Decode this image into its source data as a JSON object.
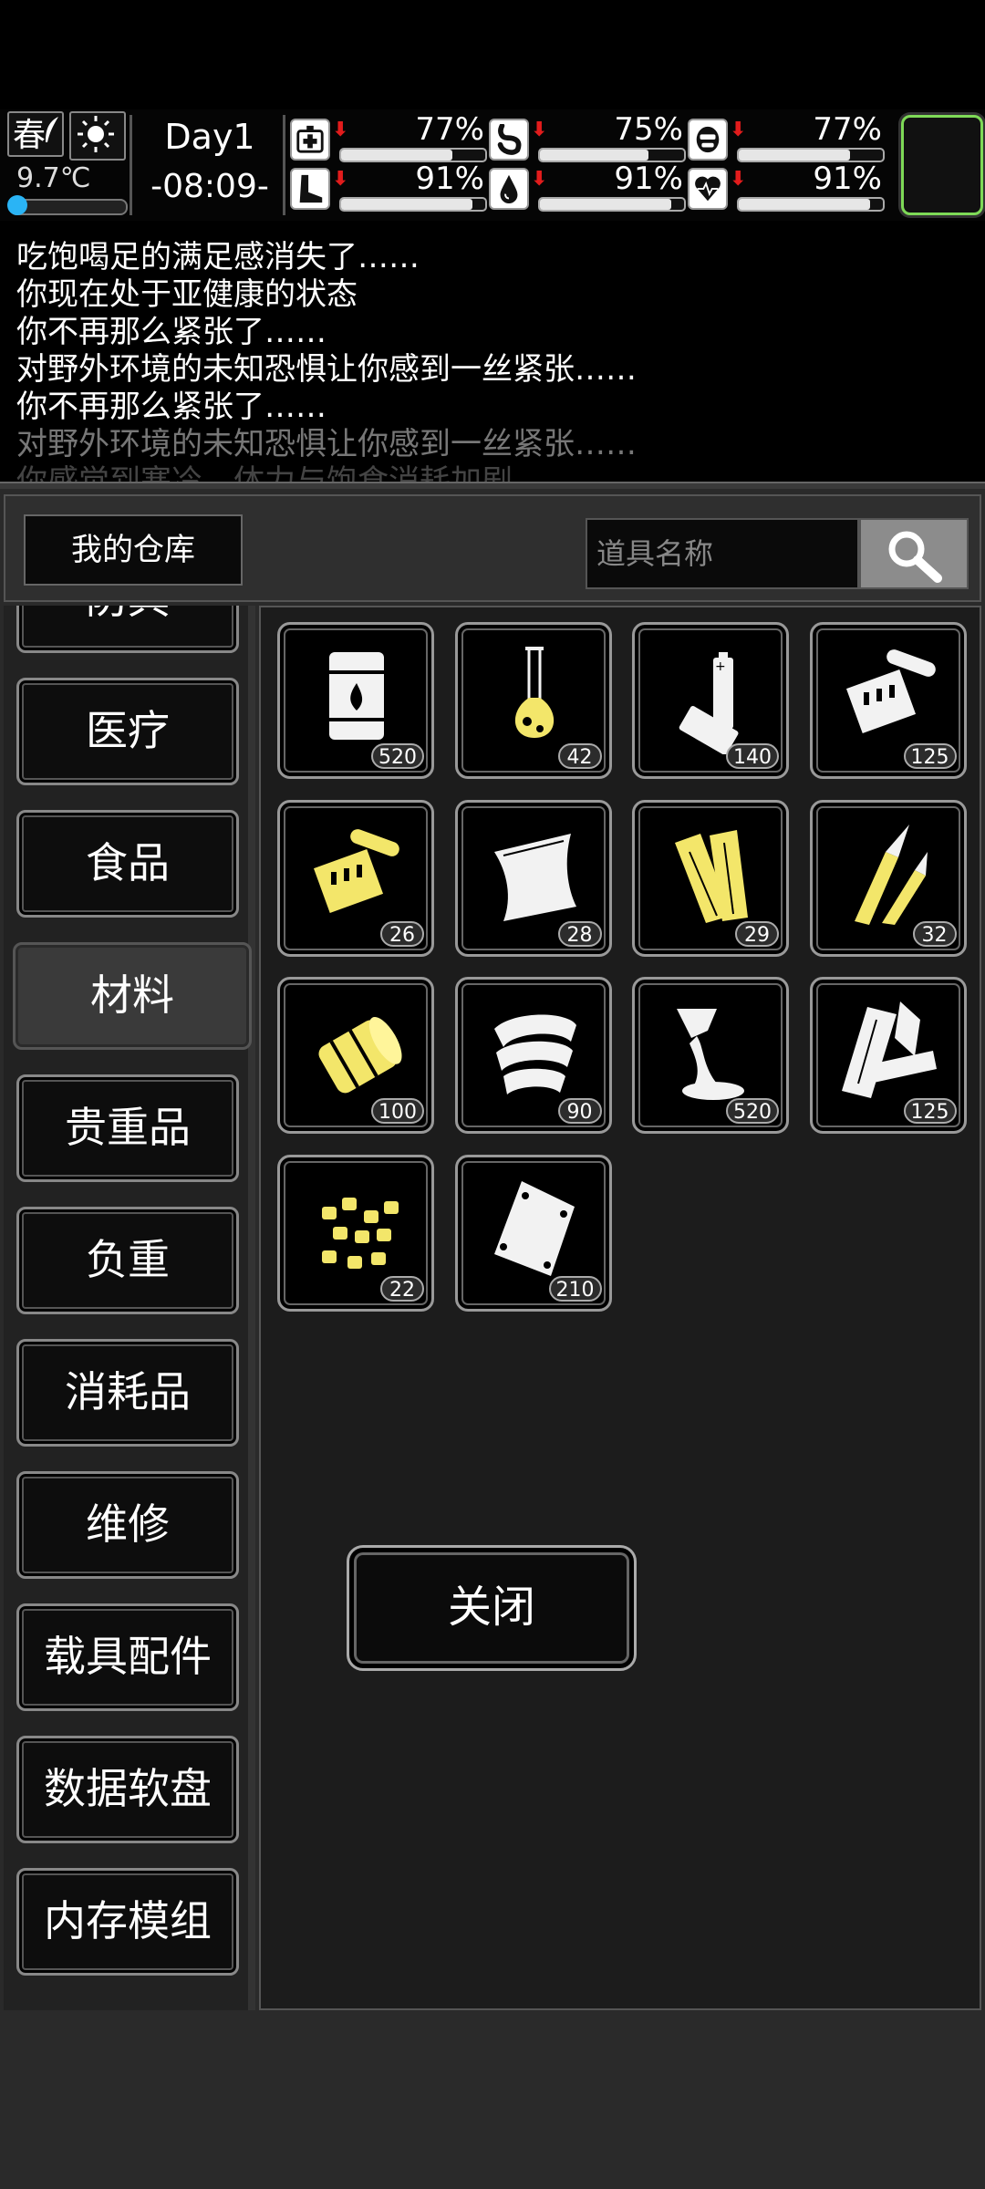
{
  "hud": {
    "season": "春",
    "temperature": "9.7℃",
    "temperature_level": 0.1,
    "day": "Day1",
    "time": "-08:09-",
    "stats": [
      {
        "icon": "medkit-icon",
        "value": "77%",
        "level": 0.77
      },
      {
        "icon": "stomach-icon",
        "value": "75%",
        "level": 0.75
      },
      {
        "icon": "mask-icon",
        "value": "77%",
        "level": 0.77
      },
      {
        "icon": "boot-icon",
        "value": "91%",
        "level": 0.91
      },
      {
        "icon": "water-drop-icon",
        "value": "91%",
        "level": 0.91
      },
      {
        "icon": "heart-icon",
        "value": "91%",
        "level": 0.91
      }
    ]
  },
  "log": [
    "吃饱喝足的满足感消失了……",
    "你现在处于亚健康的状态",
    "你不再那么紧张了……",
    "对野外环境的未知恐惧让你感到一丝紧张……",
    "你不再那么紧张了……",
    "对野外环境的未知恐惧让你感到一丝紧张……",
    "你感觉到寒冷，体力与饱食消耗加剧"
  ],
  "warehouse": {
    "title": "我的仓库",
    "search_placeholder": "道具名称"
  },
  "categories": [
    "防具",
    "医疗",
    "食品",
    "材料",
    "贵重品",
    "负重",
    "消耗品",
    "维修",
    "载具配件",
    "数据软盘",
    "内存模组"
  ],
  "active_category": "材料",
  "items": [
    {
      "icon": "fuel-barrel-icon",
      "count": "520"
    },
    {
      "icon": "chemical-flask-icon",
      "count": "42"
    },
    {
      "icon": "battery-icon",
      "count": "140"
    },
    {
      "icon": "electronic-parts-icon",
      "count": "125"
    },
    {
      "icon": "circuit-parts-icon",
      "count": "26"
    },
    {
      "icon": "cloth-sheet-icon",
      "count": "28"
    },
    {
      "icon": "wood-planks-icon",
      "count": "29"
    },
    {
      "icon": "sharp-blade-icon",
      "count": "32"
    },
    {
      "icon": "rubber-roll-icon",
      "count": "100"
    },
    {
      "icon": "tape-roll-icon",
      "count": "90"
    },
    {
      "icon": "glue-tube-icon",
      "count": "520"
    },
    {
      "icon": "broken-planks-icon",
      "count": "125"
    },
    {
      "icon": "scrap-pellets-icon",
      "count": "22"
    },
    {
      "icon": "plastic-bag-icon",
      "count": "210"
    }
  ],
  "footer": {
    "close_label": "关闭"
  }
}
